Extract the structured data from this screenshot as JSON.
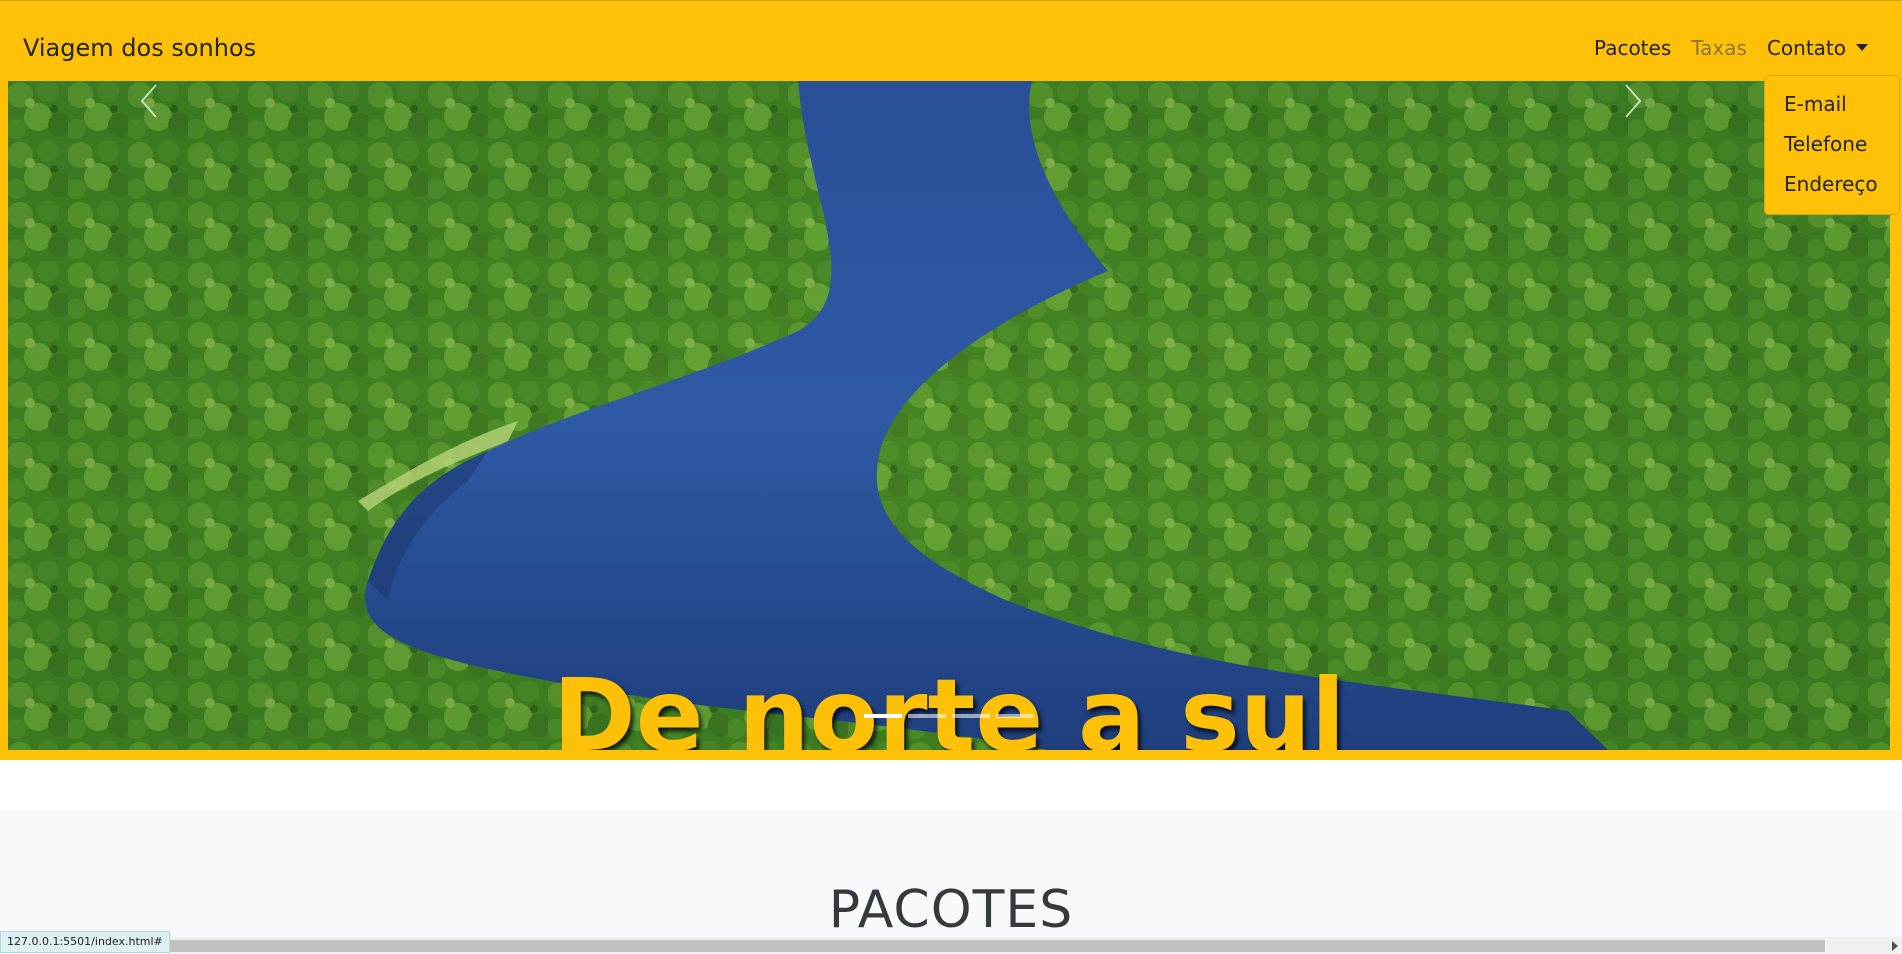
{
  "navbar": {
    "brand": "Viagem dos sonhos",
    "links": [
      {
        "label": "Pacotes"
      },
      {
        "label": "Taxas"
      },
      {
        "label": "Contato"
      }
    ],
    "dropdown": [
      {
        "label": "E-mail"
      },
      {
        "label": "Telefone"
      },
      {
        "label": "Endereço"
      }
    ]
  },
  "carousel": {
    "caption": "De norte a sul",
    "slides_count": 4,
    "active_slide": 1,
    "prev_icon": "chevron-left-icon",
    "next_icon": "chevron-right-icon"
  },
  "section": {
    "title": "PACOTES"
  },
  "status_bar": {
    "url": "127.0.0.1:5501/index.html#"
  },
  "colors": {
    "accent": "#ffc107",
    "text_dark": "#212529",
    "section_bg": "#f8f9fa"
  }
}
